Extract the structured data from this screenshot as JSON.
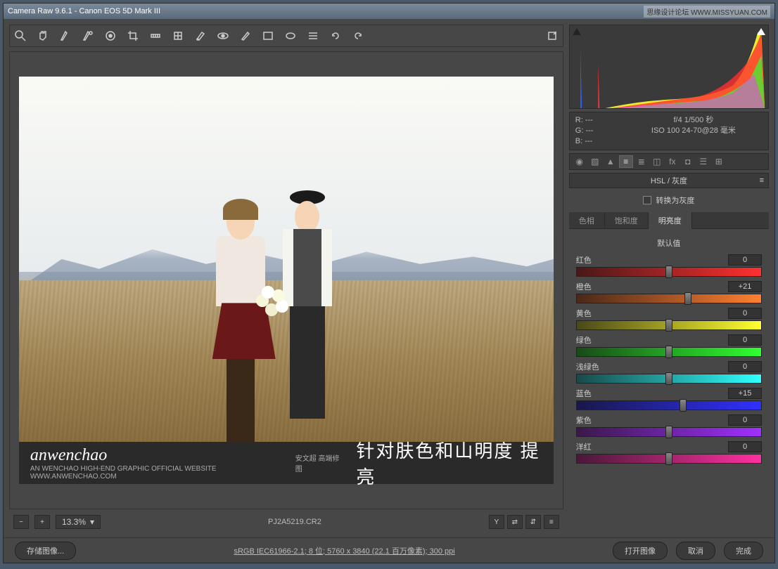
{
  "title": "Camera Raw 9.6.1  -  Canon EOS 5D Mark III",
  "watermark": "思缘设计论坛 WWW.MISSYUAN.COM",
  "zoom": "13.3%",
  "filename": "PJ2A5219.CR2",
  "preview_logo": "anwenchao",
  "preview_logo_sub1": "安文超 高端修图",
  "preview_logo_sub2": "AN WENCHAO HIGH-END GRAPHIC OFFICIAL WEBSITE WWW.ANWENCHAO.COM",
  "preview_caption": "针对肤色和山明度  提亮",
  "rgb": {
    "r": "R:  ---",
    "g": "G:  ---",
    "b": "B:  ---"
  },
  "exif": {
    "line1": "f/4  1/500 秒",
    "line2": "ISO 100  24-70@28 毫米"
  },
  "panel_title": "HSL / 灰度",
  "grayscale_label": "转换为灰度",
  "sub_tabs": [
    "色相",
    "饱和度",
    "明亮度"
  ],
  "default_label": "默认值",
  "sliders": [
    {
      "name": "红色",
      "value": 0,
      "track": "track-red",
      "key": "red"
    },
    {
      "name": "橙色",
      "value": 21,
      "display": "+21",
      "track": "track-orange",
      "key": "orange"
    },
    {
      "name": "黄色",
      "value": 0,
      "track": "track-yellow",
      "key": "yellow"
    },
    {
      "name": "绿色",
      "value": 0,
      "track": "track-green",
      "key": "green"
    },
    {
      "name": "浅绿色",
      "value": 0,
      "track": "track-aqua",
      "key": "aqua"
    },
    {
      "name": "蓝色",
      "value": 15,
      "display": "+15",
      "track": "track-blue",
      "key": "blue"
    },
    {
      "name": "紫色",
      "value": 0,
      "track": "track-purple",
      "key": "purple"
    },
    {
      "name": "洋红",
      "value": 0,
      "track": "track-magenta",
      "key": "magenta"
    }
  ],
  "footer": {
    "save": "存储图像...",
    "info": "sRGB IEC61966-2.1; 8 位; 5760 x 3840 (22.1 百万像素); 300 ppi",
    "open": "打开图像",
    "cancel": "取消",
    "done": "完成"
  },
  "bottom_icons": {
    "y": "Y"
  }
}
